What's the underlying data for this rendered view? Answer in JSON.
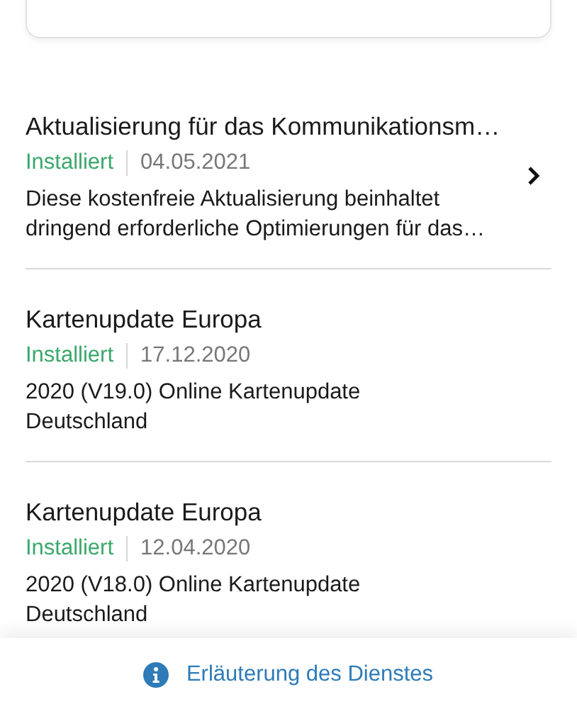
{
  "updates": [
    {
      "title": "Aktualisierung für das Kommunikationsm…",
      "status": "Installiert",
      "date": "04.05.2021",
      "description": [
        "Diese kostenfreie Aktualisierung beinhaltet",
        "dringend erforderliche Optimierungen für das…"
      ],
      "chevron": true
    },
    {
      "title": "Kartenupdate Europa",
      "status": "Installiert",
      "date": "17.12.2020",
      "description": [
        "2020 (V19.0) Online Kartenupdate",
        "Deutschland"
      ],
      "chevron": false
    },
    {
      "title": "Kartenupdate Europa",
      "status": "Installiert",
      "date": "12.04.2020",
      "description": [
        "2020 (V18.0) Online Kartenupdate",
        "Deutschland"
      ],
      "chevron": false
    }
  ],
  "footer": {
    "link": "Erläuterung des Dienstes"
  }
}
